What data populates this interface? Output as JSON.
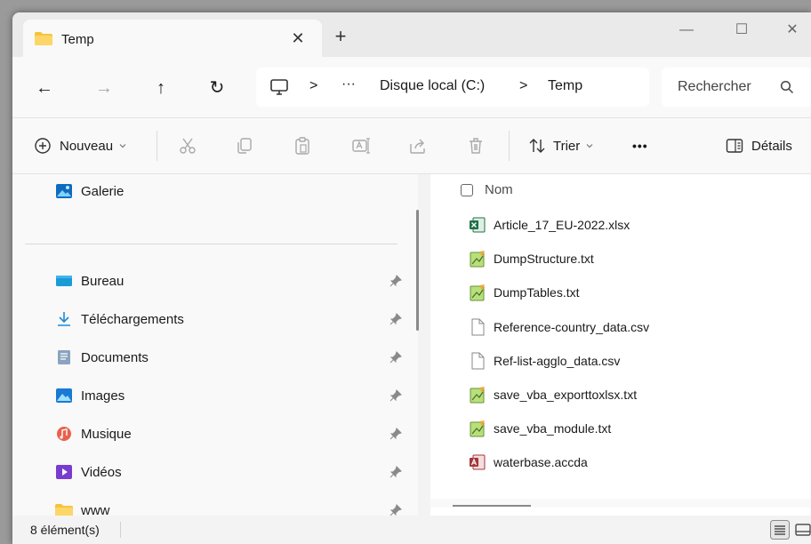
{
  "tab": {
    "title": "Temp",
    "close": "✕",
    "new_tab": "+"
  },
  "window_controls": {
    "minimize": "—",
    "maximize": "☐",
    "close": "✕"
  },
  "nav": {
    "back": "←",
    "forward": "→",
    "up": "↑",
    "refresh": "↻"
  },
  "address": {
    "sep1": ">",
    "more": "···",
    "drive": "Disque local (C:)",
    "sep2": ">",
    "folder": "Temp"
  },
  "search": {
    "placeholder": "Rechercher"
  },
  "toolbar": {
    "new_label": "Nouveau",
    "sort_label": "Trier",
    "more": "•••",
    "details_label": "Détails"
  },
  "sidebar": {
    "top": {
      "label": "Galerie",
      "icon": "gallery-icon"
    },
    "pinned": [
      {
        "label": "Bureau",
        "icon": "desktop-icon"
      },
      {
        "label": "Téléchargements",
        "icon": "download-icon"
      },
      {
        "label": "Documents",
        "icon": "documents-icon"
      },
      {
        "label": "Images",
        "icon": "pictures-icon"
      },
      {
        "label": "Musique",
        "icon": "music-icon"
      },
      {
        "label": "Vidéos",
        "icon": "videos-icon"
      },
      {
        "label": "www",
        "icon": "folder-icon"
      }
    ]
  },
  "columns": {
    "name": "Nom"
  },
  "files": [
    {
      "name": "Article_17_EU-2022.xlsx",
      "icon": "excel-icon"
    },
    {
      "name": "DumpStructure.txt",
      "icon": "notepad-icon"
    },
    {
      "name": "DumpTables.txt",
      "icon": "notepad-icon"
    },
    {
      "name": "Reference-country_data.csv",
      "icon": "file-icon"
    },
    {
      "name": "Ref-list-agglo_data.csv",
      "icon": "file-icon"
    },
    {
      "name": "save_vba_exporttoxlsx.txt",
      "icon": "notepad-icon"
    },
    {
      "name": "save_vba_module.txt",
      "icon": "notepad-icon"
    },
    {
      "name": "waterbase.accda",
      "icon": "access-icon"
    }
  ],
  "status": {
    "count": "8 élément(s)"
  },
  "colors": {
    "accent": "#0067c0",
    "folder": "#f8c33a",
    "excel": "#1d7145",
    "access": "#a4373a"
  }
}
